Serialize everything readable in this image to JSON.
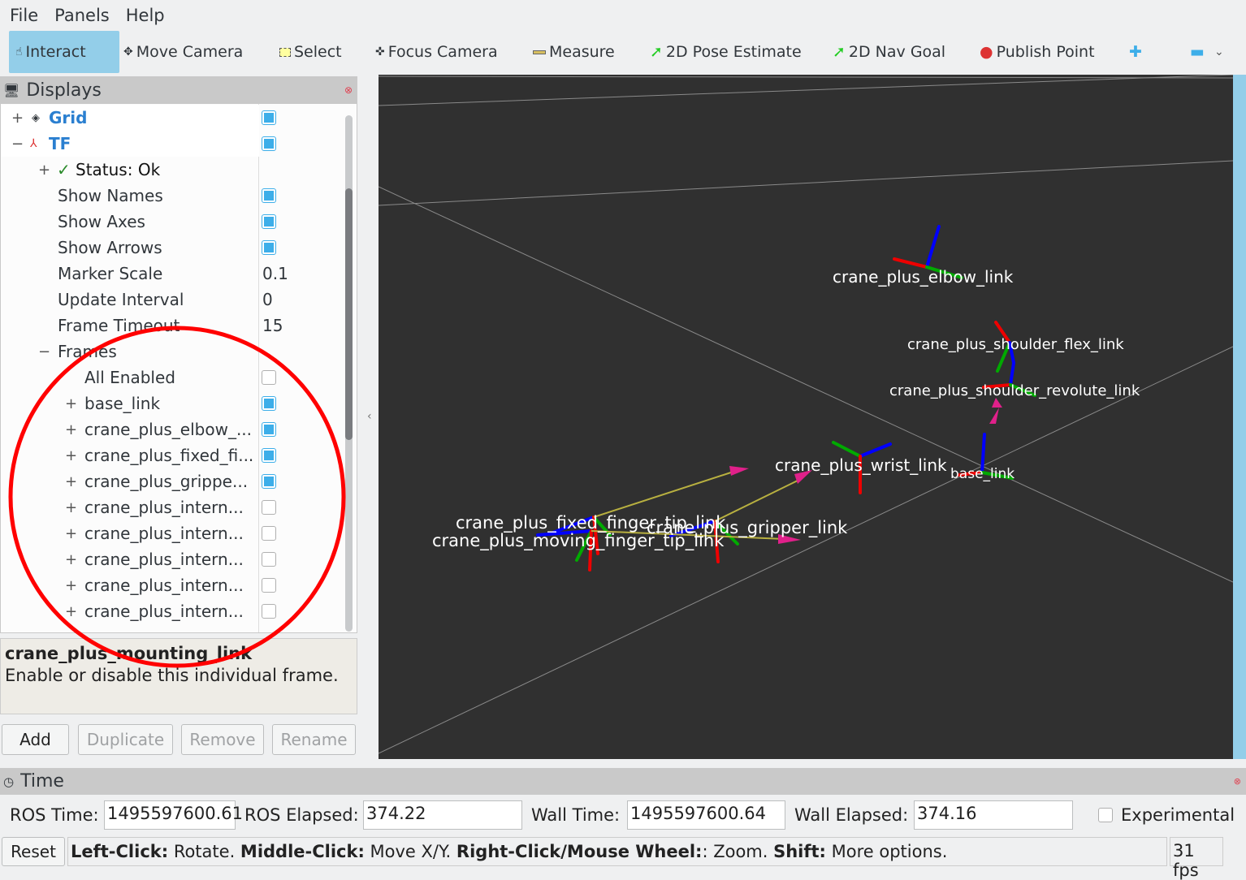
{
  "menu": {
    "file": "File",
    "panels": "Panels",
    "help": "Help"
  },
  "toolbar": {
    "interact": "Interact",
    "move_camera": "Move Camera",
    "select": "Select",
    "focus_camera": "Focus Camera",
    "measure": "Measure",
    "pose_estimate": "2D Pose Estimate",
    "nav_goal": "2D Nav Goal",
    "publish_point": "Publish Point"
  },
  "displays": {
    "title": "Displays",
    "grid": {
      "label": "Grid",
      "checked": true
    },
    "tf": {
      "label": "TF",
      "checked": true
    },
    "status": "Status: Ok",
    "props": [
      {
        "label": "Show Names",
        "checked": true
      },
      {
        "label": "Show Axes",
        "checked": true
      },
      {
        "label": "Show Arrows",
        "checked": true
      },
      {
        "label": "Marker Scale",
        "value": "0.1"
      },
      {
        "label": "Update Interval",
        "value": "0"
      },
      {
        "label": "Frame Timeout",
        "value": "15"
      }
    ],
    "frames_label": "Frames",
    "all_enabled": "All Enabled",
    "frames": [
      {
        "label": "base_link",
        "checked": true
      },
      {
        "label": "crane_plus_elbow_...",
        "checked": true
      },
      {
        "label": "crane_plus_fixed_fi...",
        "checked": true
      },
      {
        "label": "crane_plus_grippe...",
        "checked": true
      },
      {
        "label": "crane_plus_intern...",
        "checked": false
      },
      {
        "label": "crane_plus_intern...",
        "checked": false
      },
      {
        "label": "crane_plus_intern...",
        "checked": false
      },
      {
        "label": "crane_plus_intern...",
        "checked": false
      },
      {
        "label": "crane_plus_intern...",
        "checked": false
      }
    ],
    "desc_title": "crane_plus_mounting_link",
    "desc_text": "Enable or disable this individual frame.",
    "buttons": {
      "add": "Add",
      "duplicate": "Duplicate",
      "remove": "Remove",
      "rename": "Rename"
    }
  },
  "view": {
    "labels": {
      "elbow": "crane_plus_elbow_link",
      "shoulder_flex": "crane_plus_shoulder_flex_link",
      "shoulder_revolute": "crane_plus_shoulder_revolute_link",
      "wrist": "crane_plus_wrist_link",
      "base": "base_link",
      "fixed_tip": "crane_plus_fixed_finger_tip_link",
      "gripper": "crane_plus_gripper_link",
      "moving_tip": "crane_plus_moving_finger_tip_link"
    },
    "background": "#303030"
  },
  "time": {
    "title": "Time",
    "ros_time_label": "ROS Time:",
    "ros_time": "1495597600.61",
    "ros_elapsed_label": "ROS Elapsed:",
    "ros_elapsed": "374.22",
    "wall_time_label": "Wall Time:",
    "wall_time": "1495597600.64",
    "wall_elapsed_label": "Wall Elapsed:",
    "wall_elapsed": "374.16",
    "experimental": "Experimental"
  },
  "status_bar": {
    "reset": "Reset",
    "left": "Left-Click:",
    "left_t": " Rotate. ",
    "middle": "Middle-Click:",
    "middle_t": " Move X/Y. ",
    "right": "Right-Click/Mouse Wheel:",
    "right_t": ": Zoom. ",
    "shift": "Shift:",
    "shift_t": " More options.",
    "fps": "31 fps"
  }
}
